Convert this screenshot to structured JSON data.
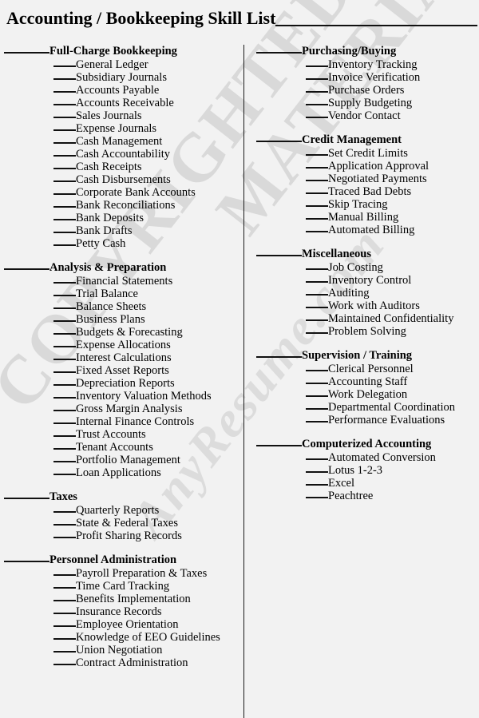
{
  "document": {
    "title": "Accounting / Bookkeeping Skill List",
    "watermark": {
      "line1": "COPYRIGHTED",
      "line2": "MATERIAL",
      "line3": "AnyResume.com"
    }
  },
  "columns": {
    "left": [
      {
        "header": "Full-Charge Bookkeeping",
        "items": [
          "General Ledger",
          "Subsidiary Journals",
          "Accounts Payable",
          "Accounts Receivable",
          "Sales Journals",
          "Expense Journals",
          "Cash Management",
          "Cash Accountability",
          "Cash Receipts",
          "Cash Disbursements",
          "Corporate Bank Accounts",
          "Bank Reconciliations",
          "Bank Deposits",
          "Bank Drafts",
          "Petty Cash"
        ]
      },
      {
        "header": "Analysis & Preparation",
        "items": [
          "Financial Statements",
          "Trial Balance",
          "Balance Sheets",
          "Business Plans",
          "Budgets & Forecasting",
          "Expense Allocations",
          "Interest Calculations",
          "Fixed Asset Reports",
          "Depreciation Reports",
          "Inventory Valuation Methods",
          "Gross Margin Analysis",
          "Internal Finance Controls",
          "Trust Accounts",
          "Tenant Accounts",
          "Portfolio Management",
          "Loan Applications"
        ]
      },
      {
        "header": "Taxes",
        "items": [
          "Quarterly Reports",
          "State & Federal Taxes",
          "Profit Sharing Records"
        ]
      },
      {
        "header": "Personnel Administration",
        "items": [
          "Payroll Preparation & Taxes",
          "Time Card Tracking",
          "Benefits Implementation",
          "Insurance Records",
          "Employee Orientation",
          "Knowledge of EEO Guidelines",
          "Union Negotiation",
          "Contract Administration"
        ]
      }
    ],
    "right": [
      {
        "header": "Purchasing/Buying",
        "items": [
          "Inventory Tracking",
          "Invoice Verification",
          "Purchase Orders",
          "Supply Budgeting",
          "Vendor Contact"
        ]
      },
      {
        "header": "Credit Management",
        "items": [
          "Set Credit Limits",
          "Application Approval",
          "Negotiated Payments",
          "Traced Bad Debts",
          "Skip Tracing",
          "Manual Billing",
          "Automated Billing"
        ]
      },
      {
        "header": "Miscellaneous",
        "items": [
          "Job Costing",
          "Inventory Control",
          "Auditing",
          "Work with Auditors",
          "Maintained Confidentiality",
          "Problem Solving"
        ]
      },
      {
        "header": "Supervision / Training",
        "items": [
          "Clerical Personnel",
          "Accounting Staff",
          "Work Delegation",
          "Departmental Coordination",
          "Performance Evaluations"
        ]
      },
      {
        "header": "Computerized Accounting",
        "items": [
          "Automated Conversion",
          "Lotus 1-2-3",
          "Excel",
          "Peachtree"
        ]
      }
    ]
  }
}
